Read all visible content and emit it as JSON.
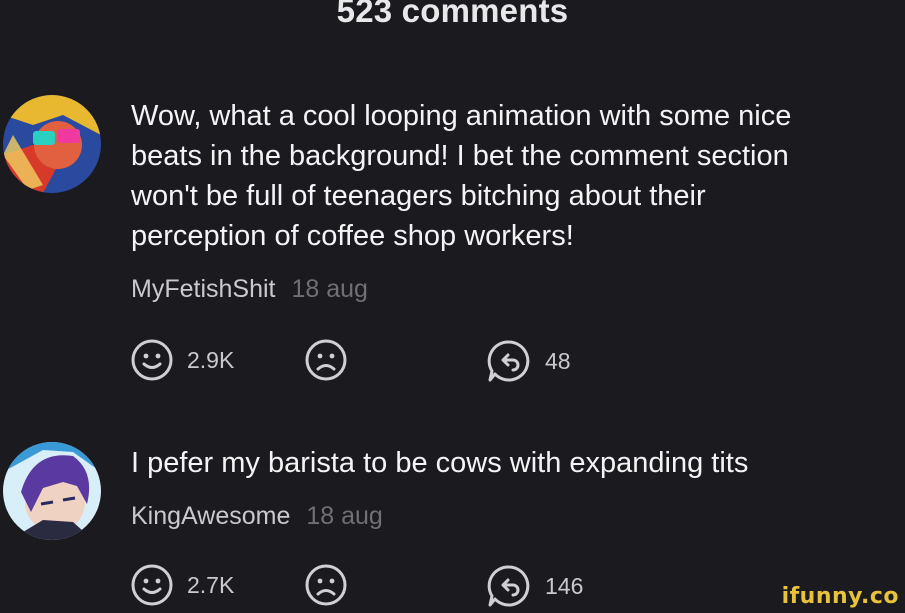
{
  "header": {
    "title": "523 comments"
  },
  "comments": [
    {
      "text": "Wow, what a cool looping animation with some nice\nbeats in the background! I bet the comment section\nwon't be full of teenagers bitching about their\nperception of coffee shop workers!",
      "author": "MyFetishShit",
      "date": "18 aug",
      "likes": "2.9K",
      "replies": "48"
    },
    {
      "text": "I pefer my barista to be cows with expanding tits",
      "author": "KingAwesome",
      "date": "18 aug",
      "likes": "2.7K",
      "replies": "146"
    }
  ],
  "icons": {
    "like": "smile-icon",
    "dislike": "frown-icon",
    "reply": "reply-arrow-icon"
  },
  "watermark": "ifunny.co",
  "colors": {
    "background": "#1b1b1f",
    "text": "#f4f4f6",
    "muted": "#6f6f76",
    "watermark": "#e8c23a"
  }
}
